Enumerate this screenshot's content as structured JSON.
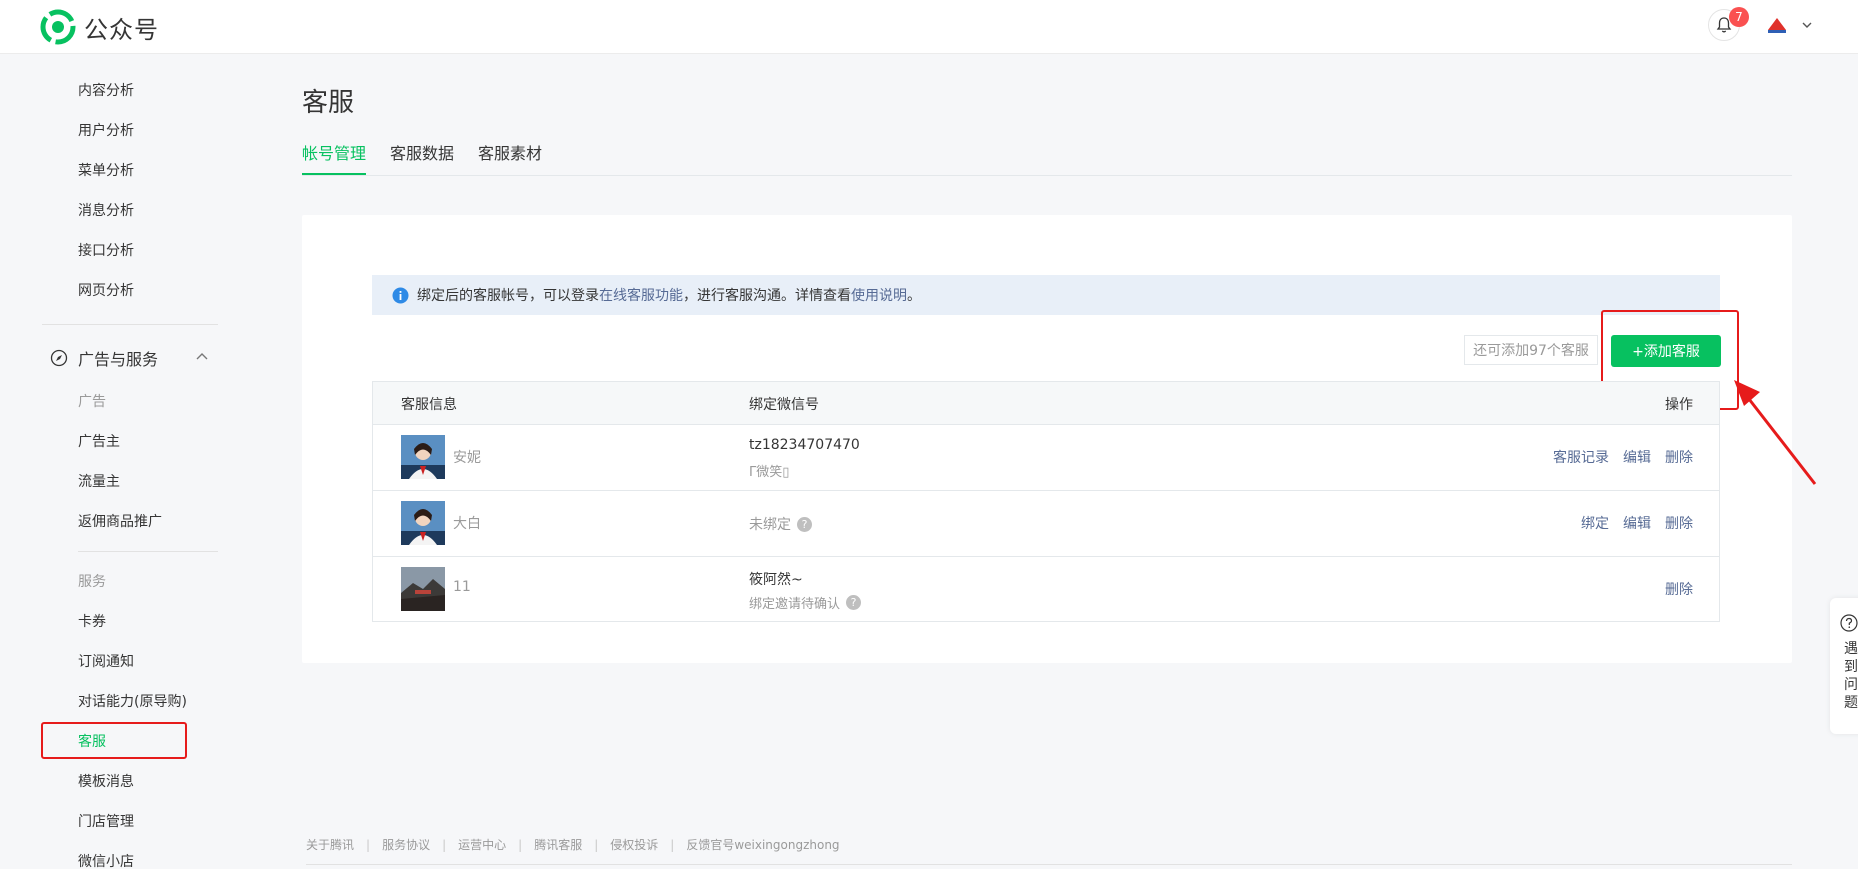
{
  "header": {
    "logo_text": "公众号",
    "notification_count": "7",
    "brand_color": "#07c160"
  },
  "sidebar": {
    "items_top": [
      {
        "label": "内容分析"
      },
      {
        "label": "用户分析"
      },
      {
        "label": "菜单分析"
      },
      {
        "label": "消息分析"
      },
      {
        "label": "接口分析"
      },
      {
        "label": "网页分析"
      }
    ],
    "group_label": "广告与服务",
    "ads_category": "广告",
    "ads_items": [
      {
        "label": "广告主"
      },
      {
        "label": "流量主"
      },
      {
        "label": "返佣商品推广"
      }
    ],
    "service_category": "服务",
    "service_items": [
      {
        "label": "卡券"
      },
      {
        "label": "订阅通知"
      },
      {
        "label": "对话能力(原导购)"
      },
      {
        "label": "客服"
      },
      {
        "label": "模板消息"
      },
      {
        "label": "门店管理"
      },
      {
        "label": "微信小店"
      }
    ]
  },
  "main": {
    "title": "客服",
    "tabs": [
      {
        "label": "帐号管理"
      },
      {
        "label": "客服数据"
      },
      {
        "label": "客服素材"
      }
    ],
    "notice": {
      "part1": "绑定后的客服帐号，可以登录",
      "link1": "在线客服功能",
      "part2": "，进行客服沟通。详情查看",
      "link2": "使用说明",
      "part3": "。"
    },
    "remaining_text": "还可添加97个客服",
    "add_button": "+添加客服",
    "table": {
      "headers": {
        "info": "客服信息",
        "wx": "绑定微信号",
        "ops": "操作"
      },
      "rows": [
        {
          "name": "安妮",
          "wx": "tz18234707470",
          "wx_sub": "Γ微笑▯",
          "ops": [
            "客服记录",
            "编辑",
            "删除"
          ]
        },
        {
          "name": "大白",
          "wx": "",
          "wx_sub": "未绑定",
          "ops": [
            "绑定",
            "编辑",
            "删除"
          ]
        },
        {
          "name": "11",
          "wx": "筱阿然~",
          "wx_sub": "绑定邀请待确认",
          "ops": [
            "删除"
          ]
        }
      ]
    }
  },
  "help_text": "遇到问题",
  "footer": {
    "links": [
      {
        "label": "关于腾讯"
      },
      {
        "label": "服务协议"
      },
      {
        "label": "运营中心"
      },
      {
        "label": "腾讯客服"
      },
      {
        "label": "侵权投诉"
      },
      {
        "label": "反馈官号weixingongzhong"
      }
    ]
  }
}
